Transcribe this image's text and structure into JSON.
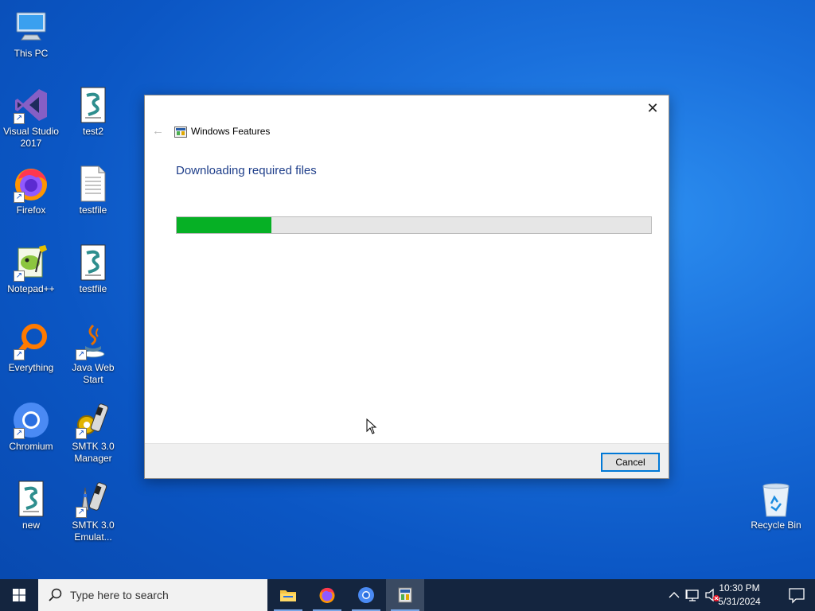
{
  "desktop": {
    "icons": [
      {
        "label": "This PC",
        "icon": "this-pc-icon"
      },
      {
        "label": "Visual Studio 2017",
        "icon": "visual-studio-icon"
      },
      {
        "label": "test2",
        "icon": "script-file-icon"
      },
      {
        "label": "Firefox",
        "icon": "firefox-icon"
      },
      {
        "label": "testfile",
        "icon": "text-file-icon"
      },
      {
        "label": "Notepad++",
        "icon": "notepadpp-icon"
      },
      {
        "label": "testfile",
        "icon": "script-file-icon"
      },
      {
        "label": "Everything",
        "icon": "everything-icon"
      },
      {
        "label": "Java Web Start",
        "icon": "java-icon"
      },
      {
        "label": "Chromium",
        "icon": "chromium-icon"
      },
      {
        "label": "SMTK 3.0 Manager",
        "icon": "smtk-manager-icon"
      },
      {
        "label": "new",
        "icon": "script-file-icon"
      },
      {
        "label": "SMTK 3.0 Emulat...",
        "icon": "smtk-emulator-icon"
      },
      {
        "label": "Recycle Bin",
        "icon": "recycle-bin-icon"
      }
    ]
  },
  "dialog": {
    "title": "Windows Features",
    "heading": "Downloading required files",
    "progress": 0.2,
    "cancel_label": "Cancel",
    "close_glyph": "✕",
    "back_glyph": "←"
  },
  "taskbar": {
    "search_placeholder": "Type here to search",
    "pinned": [
      "file-explorer-icon",
      "firefox-icon",
      "chromium-icon",
      "windows-features-icon"
    ],
    "clock_time": "10:30 PM",
    "clock_date": "5/31/2024"
  },
  "colors": {
    "progress_fill": "#06b025",
    "heading": "#1e3e8a",
    "accent": "#0078d7",
    "taskbar": "#14253f"
  }
}
